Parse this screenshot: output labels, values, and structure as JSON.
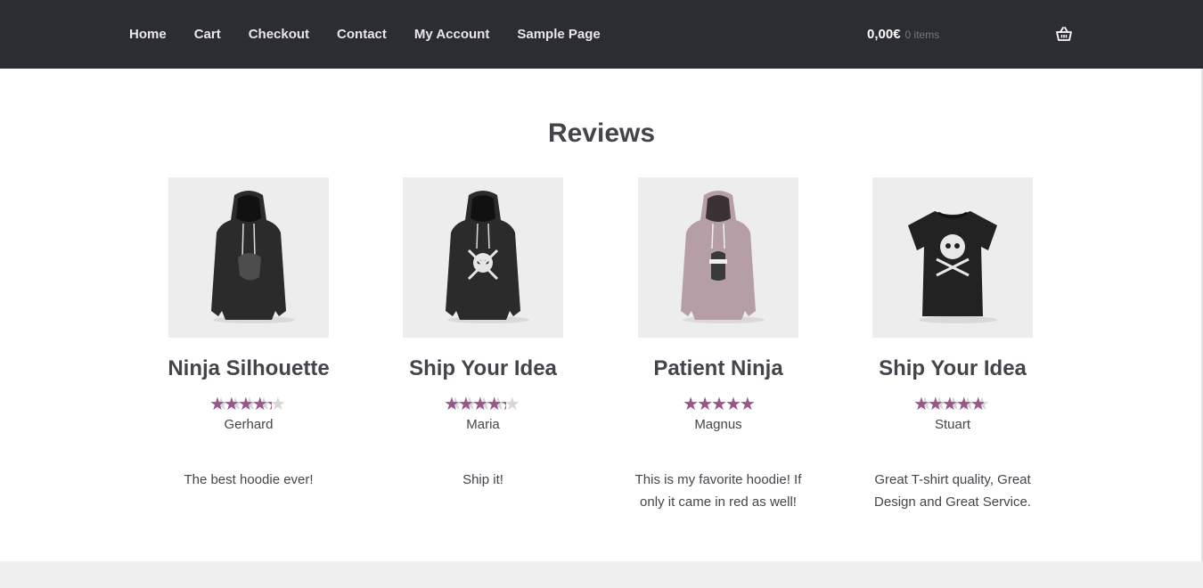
{
  "nav": {
    "items": [
      {
        "label": "Home"
      },
      {
        "label": "Cart"
      },
      {
        "label": "Checkout"
      },
      {
        "label": "Contact"
      },
      {
        "label": "My Account"
      },
      {
        "label": "Sample Page"
      }
    ]
  },
  "cart": {
    "amount": "0,00€",
    "count": "0 items",
    "icon": "basket-icon"
  },
  "section": {
    "title": "Reviews"
  },
  "reviews": [
    {
      "product": "Ninja Silhouette",
      "rating": 4,
      "reviewer": "Gerhard",
      "comment": "The best hoodie ever!",
      "image": "hoodie-black"
    },
    {
      "product": "Ship Your Idea",
      "rating": 4,
      "reviewer": "Maria",
      "comment": "Ship it!",
      "image": "hoodie-black-skull"
    },
    {
      "product": "Patient Ninja",
      "rating": 5,
      "reviewer": "Magnus",
      "comment": "This is my favorite hoodie! If only it came in red as well!",
      "image": "hoodie-pink"
    },
    {
      "product": "Ship Your Idea",
      "rating": 4.5,
      "reviewer": "Stuart",
      "comment": "Great T-shirt quality, Great Design and Great Service.",
      "image": "tshirt-black-skull"
    }
  ],
  "colors": {
    "header_bg": "#2c2d33",
    "star_active": "#96588a",
    "star_inactive": "#d6d6d6",
    "text": "#43454b",
    "thumb_bg": "#ededed"
  }
}
